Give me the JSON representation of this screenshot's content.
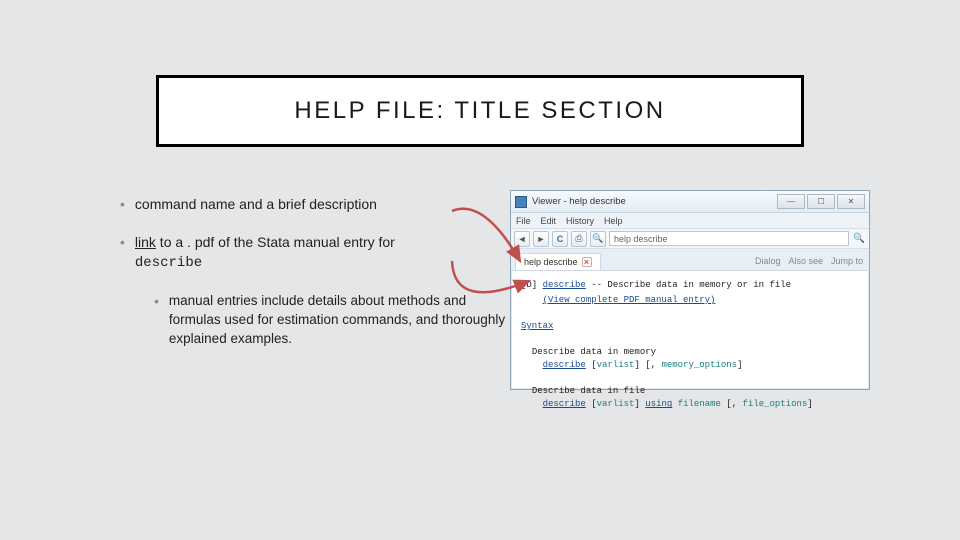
{
  "title": "HELP FILE: TITLE SECTION",
  "bullets": {
    "b1": "command name and a brief description",
    "b2_link": "link",
    "b2_rest": " to a . pdf of the Stata manual entry for ",
    "b2_code": "describe",
    "b3": "manual entries include details about methods and formulas used for estimation commands, and thoroughly explained examples."
  },
  "viewer": {
    "windowTitle": "Viewer - help describe",
    "menu": {
      "file": "File",
      "edit": "Edit",
      "history": "History",
      "help": "Help"
    },
    "address": "help describe",
    "tabLabel": "help describe",
    "controls": {
      "dialog": "Dialog",
      "alsosee": "Also see",
      "jumpto": "Jump to"
    },
    "body": {
      "line1_pre": "[D] ",
      "line1_cmd": "describe",
      "line1_rest": " -- Describe data in memory or in file",
      "pdfLink": "(View complete PDF manual entry)",
      "syntaxHdr": "Syntax",
      "group1_title": "Describe data in memory",
      "group1_cmd": "describe",
      "group1_opt_varlist": "varlist",
      "group1_opt_memopts": "memory_options",
      "group2_title": "Describe data in file",
      "group2_cmd": "describe",
      "group2_opt_varlist": "varlist",
      "group2_using": "using",
      "group2_filename": "filename",
      "group2_fileopts": "file_options"
    }
  }
}
